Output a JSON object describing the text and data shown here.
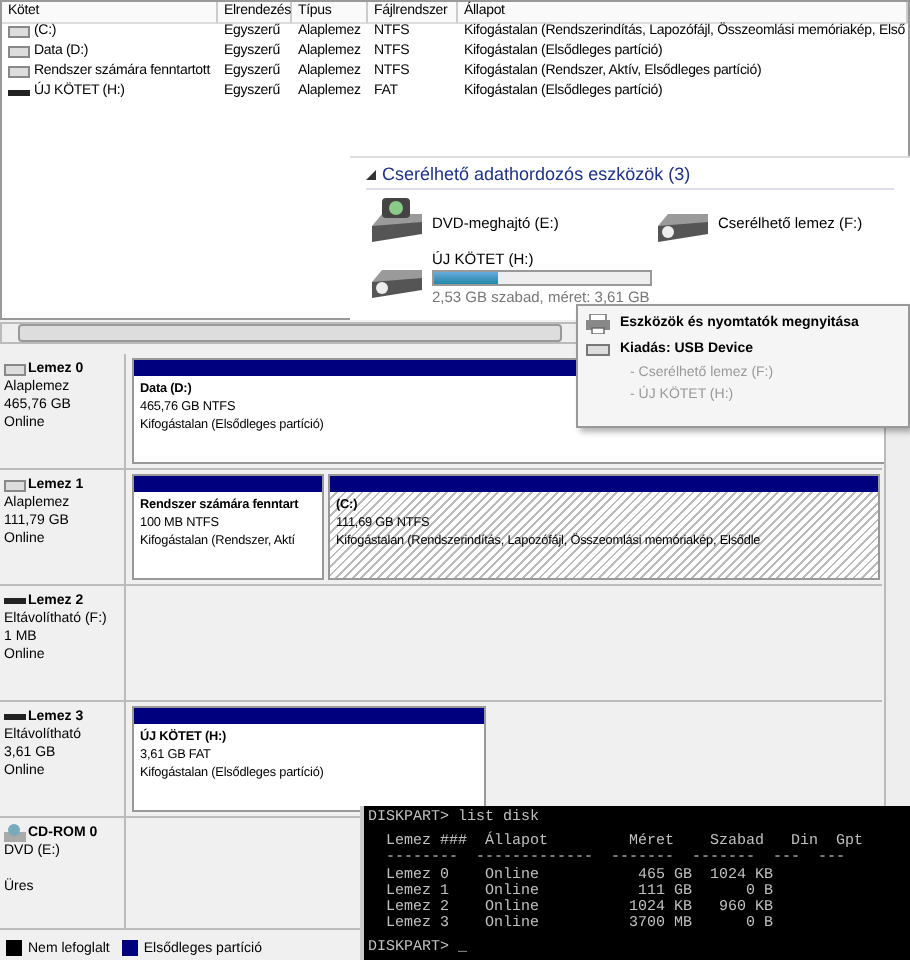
{
  "volumes": {
    "columns": [
      "Kötet",
      "Elrendezés",
      "Típus",
      "Fájlrendszer",
      "Állapot"
    ],
    "rows": [
      {
        "kind": "fixed",
        "cells": [
          "(C:)",
          "Egyszerű",
          "Alaplemez",
          "NTFS",
          "Kifogástalan (Rendszerindítás, Lapozófájl, Összeomlási memóriakép, Első"
        ]
      },
      {
        "kind": "fixed",
        "cells": [
          "Data (D:)",
          "Egyszerű",
          "Alaplemez",
          "NTFS",
          "Kifogástalan (Elsődleges partíció)"
        ]
      },
      {
        "kind": "fixed",
        "cells": [
          "Rendszer számára fenntartott",
          "Egyszerű",
          "Alaplemez",
          "NTFS",
          "Kifogástalan (Rendszer, Aktív, Elsődleges partíció)"
        ]
      },
      {
        "kind": "removable",
        "cells": [
          "ÚJ KÖTET (H:)",
          "Egyszerű",
          "Alaplemez",
          "FAT",
          "Kifogástalan (Elsődleges partíció)"
        ]
      }
    ]
  },
  "disks": [
    {
      "kind": "fixed",
      "name": "Lemez 0",
      "type": "Alaplemez",
      "size": "465,76 GB",
      "status": "Online",
      "partitions": [
        {
          "name": "Data  (D:)",
          "size": "465,76 GB NTFS",
          "status": "Kifogástalan (Elsődleges partíció)",
          "selected": false
        }
      ]
    },
    {
      "kind": "fixed",
      "name": "Lemez 1",
      "type": "Alaplemez",
      "size": "111,79 GB",
      "status": "Online",
      "partitions": [
        {
          "name": "Rendszer számára fenntart",
          "size": "100 MB NTFS",
          "status": "Kifogástalan (Rendszer, Aktí",
          "selected": false
        },
        {
          "name": "(C:)",
          "size": "111,69 GB NTFS",
          "status": "Kifogástalan (Rendszerindítás, Lapozófájl, Összeomlási memóriakép, Elsődle",
          "selected": true
        }
      ]
    },
    {
      "kind": "removable",
      "name": "Lemez 2",
      "type": "Eltávolítható (F:)",
      "size": "1 MB",
      "status": "Online"
    },
    {
      "kind": "removable",
      "name": "Lemez 3",
      "type": "Eltávolítható",
      "size": "3,61 GB",
      "status": "Online",
      "partitions": [
        {
          "name": "ÚJ KÖTET  (H:)",
          "size": "3,61 GB FAT",
          "status": "Kifogástalan (Elsődleges partíció)",
          "selected": false
        }
      ]
    },
    {
      "kind": "optical",
      "name": "CD-ROM 0",
      "type": "DVD (E:)",
      "status": "Üres"
    }
  ],
  "legend": [
    {
      "label": "Nem lefoglalt",
      "color": "#000000"
    },
    {
      "label": "Elsődleges partíció",
      "color": "#00007f"
    }
  ],
  "explorer": {
    "group": "Cserélhető adathordozós eszközök (3)",
    "expanded": true,
    "devices": [
      {
        "kind": "dvd",
        "name": "DVD-meghajtó (E:)"
      },
      {
        "kind": "removable",
        "name": "Cserélhető lemez (F:)"
      },
      {
        "kind": "volume",
        "name": "ÚJ KÖTET (H:)",
        "level": 0.3,
        "detail": "2,53 GB szabad, méret: 3,61 GB"
      }
    ]
  },
  "menu": {
    "items": [
      {
        "kind": "devices",
        "label": "Eszközök és nyomtatók megnyitása",
        "disabled": false
      },
      {
        "kind": "eject",
        "label": "Kiadás: USB Device",
        "disabled": false
      },
      {
        "kind": "sub",
        "label": "- Cserélhető lemez (F:)",
        "disabled": true
      },
      {
        "kind": "sub",
        "label": "- ÚJ KÖTET (H:)",
        "disabled": true
      }
    ]
  },
  "console": {
    "lines": [
      {
        "kind": "command",
        "text": "DISKPART> list disk"
      },
      {
        "kind": "header",
        "text": "  Lemez ###  Állapot         Méret    Szabad   Din  Gpt"
      },
      {
        "kind": "rule",
        "text": "  --------  -------------  -------  -------  ---  ---"
      },
      {
        "kind": "row",
        "text": "  Lemez 0    Online           465 GB  1024 KB"
      },
      {
        "kind": "row",
        "text": "  Lemez 1    Online           111 GB      0 B"
      },
      {
        "kind": "row",
        "text": "  Lemez 2    Online          1024 KB   960 KB"
      },
      {
        "kind": "row",
        "text": "  Lemez 3    Online          3700 MB      0 B"
      },
      {
        "kind": "command",
        "text": "DISKPART> _"
      }
    ]
  }
}
